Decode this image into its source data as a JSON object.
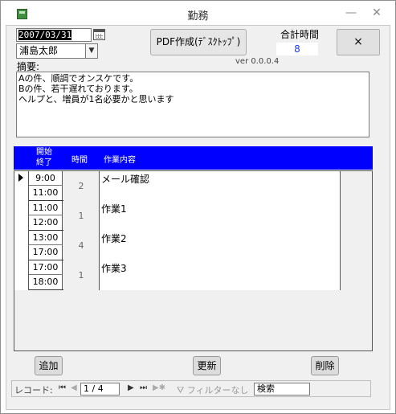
{
  "window": {
    "title": "勤務",
    "minimize": "—",
    "close": "✕"
  },
  "header": {
    "date": "2007/03/31",
    "name": "浦島太郎",
    "pdf_button": "PDF作成(ﾃﾞｽｸﾄｯﾌﾟ)",
    "total_label": "合計時間",
    "total_value": "8",
    "close_button": "×",
    "version": "ver 0.0.0.4"
  },
  "summary": {
    "label": "摘要:",
    "text": "Aの件、順調でオンスケです。\nBの件、若干遅れております。\nヘルプと、増員が1名必要かと思います"
  },
  "grid": {
    "header_start": "開始",
    "header_end": "終了",
    "header_time": "時間",
    "header_work": "作業内容",
    "rows": [
      {
        "start": "9:00",
        "end": "11:00",
        "hours": "2",
        "work": "メール確認"
      },
      {
        "start": "11:00",
        "end": "12:00",
        "hours": "1",
        "work": "作業1"
      },
      {
        "start": "13:00",
        "end": "17:00",
        "hours": "4",
        "work": "作業2"
      },
      {
        "start": "17:00",
        "end": "18:00",
        "hours": "1",
        "work": "作業3"
      }
    ]
  },
  "footer": {
    "add": "追加",
    "update": "更新",
    "delete": "削除"
  },
  "navigation": {
    "label": "レコード:",
    "position": "1 / 4",
    "filter": "フィルターなし",
    "search": "検索"
  }
}
